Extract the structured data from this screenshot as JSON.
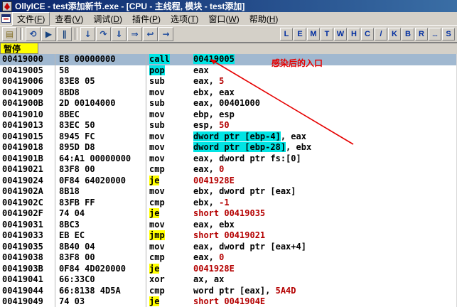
{
  "window": {
    "title": "OllyICE - test添加新节.exe - [CPU -  主线程, 模块 - test添加]"
  },
  "menu": {
    "items": [
      {
        "text": "文件",
        "key": "F",
        "active": true
      },
      {
        "text": "查看",
        "key": "V"
      },
      {
        "text": "调试",
        "key": "D"
      },
      {
        "text": "插件",
        "key": "P"
      },
      {
        "text": "选项",
        "key": "T"
      },
      {
        "text": "窗口",
        "key": "W"
      },
      {
        "text": "帮助",
        "key": "H"
      }
    ]
  },
  "toolbar": {
    "buttons": [
      {
        "name": "open-file-button",
        "glyph": "▤",
        "color": "#806A1E"
      },
      {
        "sep": true
      },
      {
        "name": "restart-button",
        "glyph": "⟲",
        "color": "#1C4A9C"
      },
      {
        "name": "run-button",
        "glyph": "▶",
        "color": "#16427E"
      },
      {
        "name": "pause-button",
        "glyph": "∥",
        "color": "#16427E"
      },
      {
        "sep": true
      },
      {
        "name": "step-into-button",
        "glyph": "↓",
        "color": "#1C4A9C"
      },
      {
        "name": "step-over-button",
        "glyph": "↷",
        "color": "#1C4A9C"
      },
      {
        "name": "trace-into-button",
        "glyph": "⇓",
        "color": "#1C4A9C"
      },
      {
        "name": "trace-over-button",
        "glyph": "⇒",
        "color": "#1C4A9C"
      },
      {
        "name": "till-return-button",
        "glyph": "↩",
        "color": "#1C4A9C"
      },
      {
        "name": "goto-button",
        "glyph": "→",
        "color": "#1C4A9C"
      }
    ],
    "letters": [
      "L",
      "E",
      "M",
      "T",
      "W",
      "H",
      "C",
      "/",
      "K",
      "B",
      "R",
      "...",
      "S"
    ]
  },
  "status": {
    "state": "暂停"
  },
  "colors": {
    "titlebar-start": "#0A246A",
    "titlebar-end": "#3A6EA5",
    "chrome": "#D4D0C8",
    "selection-blue": "#A0B8D0",
    "highlight-cyan": "#00E4E4",
    "highlight-yellow": "#FFFF00",
    "operand-red": "#B40000",
    "annotation-red": "#E60000",
    "pause-yellow": "#FFFF00",
    "letter-blue": "#002DA0"
  },
  "disasm": {
    "annotation": "感染后的入口",
    "rows": [
      {
        "a": "00419000",
        "b": "E8 00000000",
        "m": "call",
        "mc": "cyan",
        "sel": true,
        "op": [
          {
            "t": "00419005",
            "c": "h"
          }
        ]
      },
      {
        "a": "00419005",
        "b": "58",
        "m": "pop",
        "mc": "cyan",
        "op": [
          {
            "t": "eax",
            "c": "k"
          }
        ]
      },
      {
        "a": "00419006",
        "b": "83E8 05",
        "m": "sub",
        "op": [
          {
            "t": "eax, ",
            "c": "k"
          },
          {
            "t": "5",
            "c": "r"
          }
        ]
      },
      {
        "a": "00419009",
        "b": "8BD8",
        "m": "mov",
        "op": [
          {
            "t": "ebx, eax",
            "c": "k"
          }
        ]
      },
      {
        "a": "0041900B",
        "b": "2D 00104000",
        "m": "sub",
        "op": [
          {
            "t": "eax, 00401000",
            "c": "k"
          }
        ]
      },
      {
        "a": "00419010",
        "b": "8BEC",
        "m": "mov",
        "op": [
          {
            "t": "ebp, esp",
            "c": "k"
          }
        ]
      },
      {
        "a": "00419013",
        "b": "83EC 50",
        "m": "sub",
        "op": [
          {
            "t": "esp, ",
            "c": "k"
          },
          {
            "t": "50",
            "c": "r"
          }
        ]
      },
      {
        "a": "00419015",
        "b": "8945 FC",
        "m": "mov",
        "op": [
          {
            "t": "dword ptr [ebp-4]",
            "c": "h"
          },
          {
            "t": ", eax",
            "c": "k"
          }
        ]
      },
      {
        "a": "00419018",
        "b": "895D D8",
        "m": "mov",
        "op": [
          {
            "t": "dword ptr [ebp-28]",
            "c": "h"
          },
          {
            "t": ", ebx",
            "c": "k"
          }
        ]
      },
      {
        "a": "0041901B",
        "b": "64:A1 00000000",
        "m": "mov",
        "op": [
          {
            "t": "eax, dword ptr fs:[0]",
            "c": "k"
          }
        ]
      },
      {
        "a": "00419021",
        "b": "83F8 00",
        "m": "cmp",
        "op": [
          {
            "t": "eax, ",
            "c": "k"
          },
          {
            "t": "0",
            "c": "r"
          }
        ]
      },
      {
        "a": "00419024",
        "b": "0F84 64020000",
        "m": "je",
        "mc": "yellow",
        "op": [
          {
            "t": "0041928E",
            "c": "r"
          }
        ]
      },
      {
        "a": "0041902A",
        "b": "8B18",
        "m": "mov",
        "op": [
          {
            "t": "ebx, dword ptr [eax]",
            "c": "k"
          }
        ]
      },
      {
        "a": "0041902C",
        "b": "83FB FF",
        "m": "cmp",
        "op": [
          {
            "t": "ebx, ",
            "c": "k"
          },
          {
            "t": "-1",
            "c": "r"
          }
        ]
      },
      {
        "a": "0041902F",
        "b": "74 04",
        "m": "je",
        "mc": "yellow",
        "op": [
          {
            "t": "short 00419035",
            "c": "r"
          }
        ]
      },
      {
        "a": "00419031",
        "b": "8BC3",
        "m": "mov",
        "op": [
          {
            "t": "eax, ebx",
            "c": "k"
          }
        ]
      },
      {
        "a": "00419033",
        "b": "EB EC",
        "m": "jmp",
        "mc": "yellow",
        "op": [
          {
            "t": "short 00419021",
            "c": "r"
          }
        ]
      },
      {
        "a": "00419035",
        "b": "8B40 04",
        "m": "mov",
        "op": [
          {
            "t": "eax, dword ptr [eax+4]",
            "c": "k"
          }
        ]
      },
      {
        "a": "00419038",
        "b": "83F8 00",
        "m": "cmp",
        "op": [
          {
            "t": "eax, ",
            "c": "k"
          },
          {
            "t": "0",
            "c": "r"
          }
        ]
      },
      {
        "a": "0041903B",
        "b": "0F84 4D020000",
        "m": "je",
        "mc": "yellow",
        "op": [
          {
            "t": "0041928E",
            "c": "r"
          }
        ]
      },
      {
        "a": "00419041",
        "b": "66:33C0",
        "m": "xor",
        "op": [
          {
            "t": "ax, ax",
            "c": "k"
          }
        ]
      },
      {
        "a": "00419044",
        "b": "66:8138 4D5A",
        "m": "cmp",
        "op": [
          {
            "t": "word ptr [eax], ",
            "c": "k"
          },
          {
            "t": "5A4D",
            "c": "r"
          }
        ]
      },
      {
        "a": "00419049",
        "b": "74 03",
        "m": "je",
        "mc": "yellow",
        "op": [
          {
            "t": "short 0041904E",
            "c": "r"
          }
        ]
      }
    ]
  }
}
